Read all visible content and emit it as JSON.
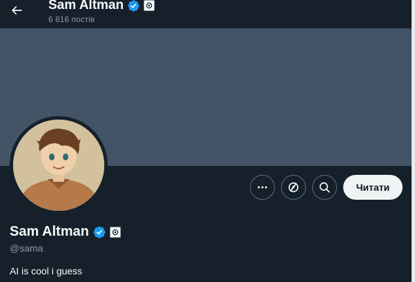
{
  "header": {
    "display_name": "Sam Altman",
    "post_count": "6 816 постів"
  },
  "profile": {
    "display_name": "Sam Altman",
    "handle": "@sama",
    "bio": "AI is cool i guess"
  },
  "actions": {
    "follow_label": "Читати"
  },
  "icons": [
    "back-arrow-icon",
    "verified-badge-icon",
    "affiliate-badge-icon",
    "more-icon",
    "subscribe-icon",
    "search-icon"
  ],
  "colors": {
    "background": "#15202b",
    "banner": "#425466",
    "verified": "#1d9bf0",
    "follow_button": "#eff3f4",
    "secondary_text": "#8b98a5"
  }
}
